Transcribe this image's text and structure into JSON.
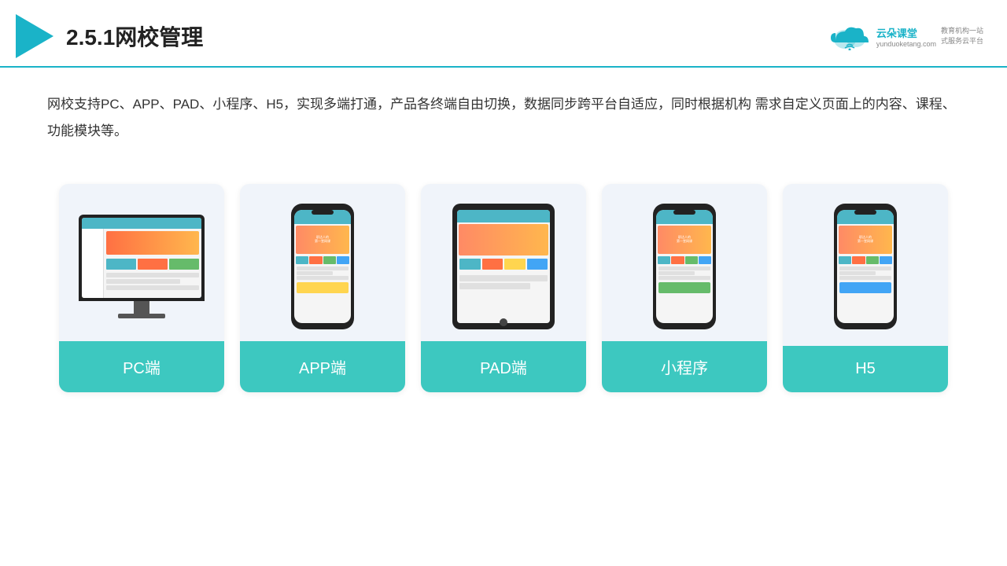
{
  "header": {
    "title": "2.5.1网校管理",
    "brand": {
      "name": "云朵课堂",
      "url": "yunduoketang.com",
      "tagline": "教育机构一站\n式服务云平台"
    }
  },
  "description": "网校支持PC、APP、PAD、小程序、H5，实现多端打通，产品各终端自由切换，数据同步跨平台自适应，同时根据机构\n需求自定义页面上的内容、课程、功能模块等。",
  "cards": [
    {
      "id": "pc",
      "label": "PC端"
    },
    {
      "id": "app",
      "label": "APP端"
    },
    {
      "id": "pad",
      "label": "PAD端"
    },
    {
      "id": "miniprogram",
      "label": "小程序"
    },
    {
      "id": "h5",
      "label": "H5"
    }
  ],
  "colors": {
    "accent": "#1ab3c8",
    "card_bg": "#f0f4fa",
    "card_label_bg": "#3dc8c0",
    "card_label_text": "#ffffff"
  }
}
